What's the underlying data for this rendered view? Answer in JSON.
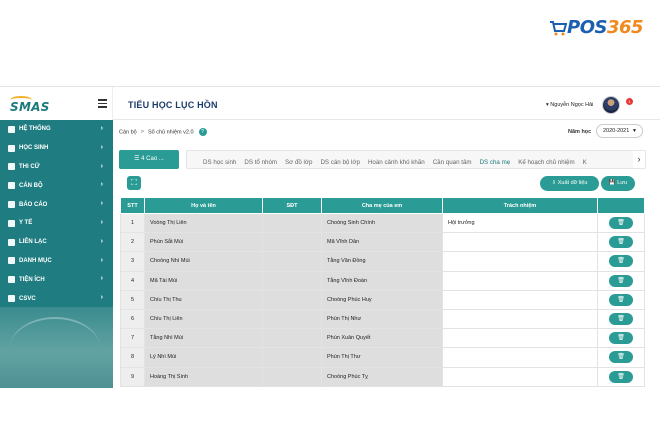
{
  "watermark": {
    "brand": "POS",
    "number": "365"
  },
  "app": {
    "logo": "SMAS",
    "school_name": "TIỂU HỌC LỤC HỒN",
    "user_name": "▾ Nguyễn Ngọc Hải",
    "notification_count": "1"
  },
  "sidebar": {
    "items": [
      {
        "label": "HỆ THỐNG",
        "icon": "settings-icon"
      },
      {
        "label": "HỌC SINH",
        "icon": "student-icon"
      },
      {
        "label": "THI CỬ",
        "icon": "exam-icon"
      },
      {
        "label": "CÁN BỘ",
        "icon": "staff-icon"
      },
      {
        "label": "BÁO CÁO",
        "icon": "report-icon"
      },
      {
        "label": "Y TẾ",
        "icon": "medical-icon"
      },
      {
        "label": "LIÊN LẠC",
        "icon": "contact-icon"
      },
      {
        "label": "DANH MỤC",
        "icon": "catalog-icon"
      },
      {
        "label": "TIỆN ÍCH",
        "icon": "utility-icon"
      },
      {
        "label": "CSVC",
        "icon": "facility-icon"
      }
    ]
  },
  "breadcrumb": {
    "root": "Cán bộ",
    "separator": ">",
    "current": "Sổ chủ nhiệm v2.0",
    "help": "?"
  },
  "year": {
    "label": "Năm học",
    "value": "2020-2021"
  },
  "class_button": "☰ 4 Cao ...",
  "tabs": [
    {
      "label": "DS học sinh",
      "active": false
    },
    {
      "label": "DS tổ nhóm",
      "active": false
    },
    {
      "label": "Sơ đồ lớp",
      "active": false
    },
    {
      "label": "DS cán bộ lớp",
      "active": false
    },
    {
      "label": "Hoàn cảnh khó khăn",
      "active": false
    },
    {
      "label": "Cần quan tâm",
      "active": false
    },
    {
      "label": "DS cha mẹ",
      "active": true
    },
    {
      "label": "Kế hoạch chủ nhiệm",
      "active": false
    },
    {
      "label": "K",
      "active": false
    }
  ],
  "actions": {
    "export": "⇩ Xuất dữ liệu",
    "save": "💾 Lưu"
  },
  "table": {
    "headers": [
      "STT",
      "Họ và tên",
      "SĐT",
      "Cha mẹ của em",
      "Trách nhiệm",
      ""
    ],
    "rows": [
      {
        "stt": "1",
        "name": "Voòng Thị Liên",
        "phone": "",
        "child": "Choòng Sinh Chính",
        "role": "Hội trưởng"
      },
      {
        "stt": "2",
        "name": "Phùn Sắt Múi",
        "phone": "",
        "child": "Mã Vĩnh Dân",
        "role": ""
      },
      {
        "stt": "3",
        "name": "Choòng Nhì Múi",
        "phone": "",
        "child": "Tằng Văn Đồng",
        "role": ""
      },
      {
        "stt": "4",
        "name": "Mã Tài Múi",
        "phone": "",
        "child": "Tằng Vĩnh Đoàn",
        "role": ""
      },
      {
        "stt": "5",
        "name": "Chíu Thị Thu",
        "phone": "",
        "child": "Choòng Phúc Huy",
        "role": ""
      },
      {
        "stt": "6",
        "name": "Chíu Thị Liên",
        "phone": "",
        "child": "Phùn Thị Như",
        "role": ""
      },
      {
        "stt": "7",
        "name": "Tằng Nhì Múi",
        "phone": "",
        "child": "Phùn Xuân Quyết",
        "role": ""
      },
      {
        "stt": "8",
        "name": "Lý Nhì Múi",
        "phone": "",
        "child": "Phùn Thị Thư",
        "role": ""
      },
      {
        "stt": "9",
        "name": "Hoàng Thị Sính",
        "phone": "",
        "child": "Choòng Phúc Tỵ",
        "role": ""
      }
    ],
    "delete_icon": "trash-icon"
  }
}
